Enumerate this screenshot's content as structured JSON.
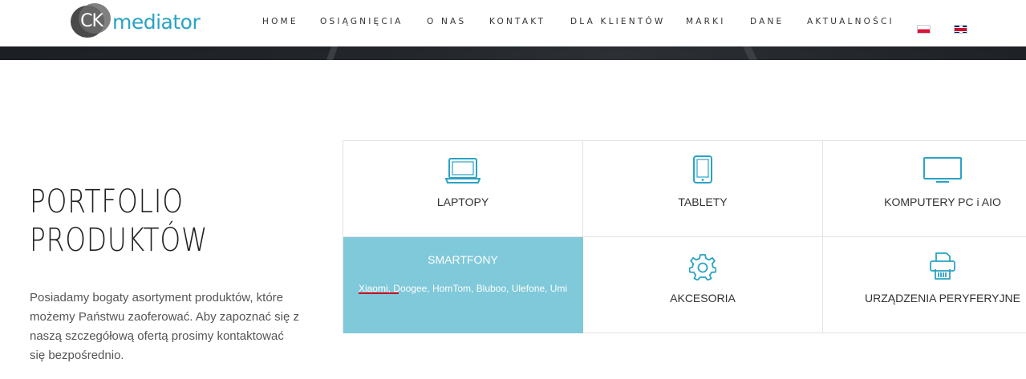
{
  "header": {
    "logo": {
      "badge": "CK",
      "text": "mediator"
    },
    "nav": [
      "HOME",
      "OSIĄGNIĘCIA",
      "O NAS",
      "KONTAKT",
      "DLA KLIENTÓW",
      "MARKI",
      "DANE",
      "AKTUALNOŚCI"
    ],
    "languages": [
      "pl-flag-icon",
      "gb-flag-icon"
    ]
  },
  "main": {
    "title_line1": "PORTFOLIO",
    "title_line2": "PRODUKTÓW",
    "description": "Posiadamy bogaty asortyment produktów, które możemy Państwu zaoferować. Aby zapoznać się z naszą szczegółową ofertą prosimy kontaktować się bezpośrednio."
  },
  "categories": [
    {
      "label": "LAPTOPY",
      "icon": "laptop-icon"
    },
    {
      "label": "TABLETY",
      "icon": "tablet-icon"
    },
    {
      "label": "KOMPUTERY PC i AIO",
      "icon": "monitor-icon"
    },
    {
      "label": "SMARTFONY",
      "icon": "",
      "brands": "Xiaomi, Doogee, HomTom, Bluboo, Ulefone, Umi",
      "active": true
    },
    {
      "label": "AKCESORIA",
      "icon": "gear-icon"
    },
    {
      "label": "URZĄDZENIA PERYFERYJNE",
      "icon": "printer-icon"
    }
  ],
  "colors": {
    "accent": "#29a3c4",
    "active_tile": "#7fc9da",
    "underline": "#d0021b"
  }
}
